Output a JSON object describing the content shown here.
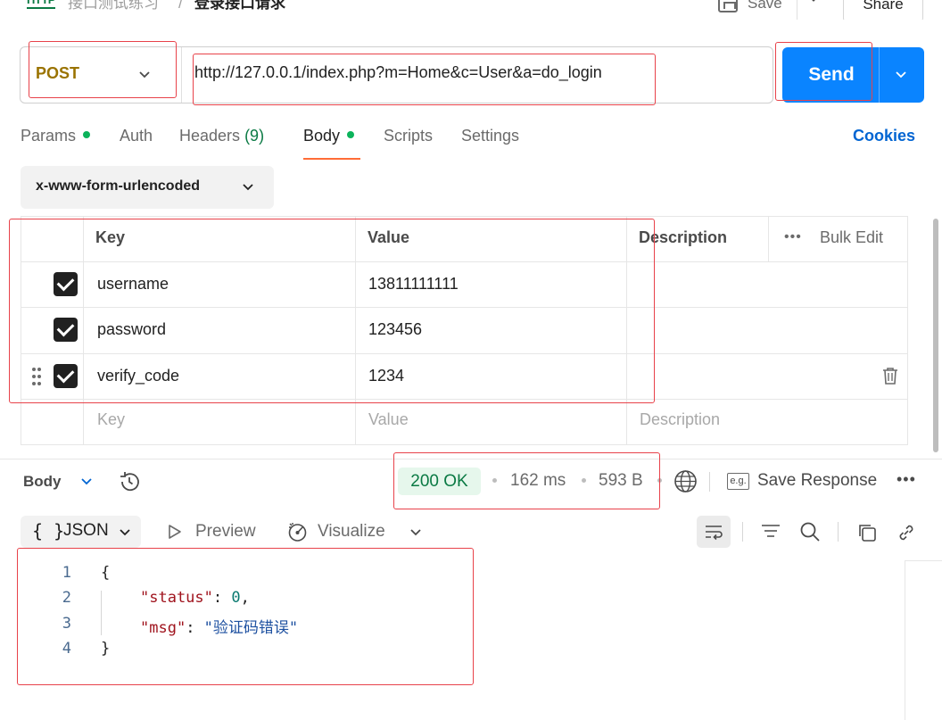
{
  "breadcrumb": {
    "badge": "HTTP",
    "parent": "接口测试练习",
    "separator": "/",
    "current": "登录接口请求"
  },
  "header_actions": {
    "save_label": "Save",
    "share_label": "Share"
  },
  "request": {
    "method": "POST",
    "url": "http://127.0.0.1/index.php?m=Home&c=User&a=do_login",
    "send_label": "Send"
  },
  "tabs": {
    "params": "Params",
    "auth": "Auth",
    "headers": "Headers",
    "headers_count": "(9)",
    "body": "Body",
    "scripts": "Scripts",
    "settings": "Settings",
    "cookies": "Cookies",
    "active": "Body"
  },
  "body_type": "x-www-form-urlencoded",
  "form_table": {
    "headers": {
      "key": "Key",
      "value": "Value",
      "description": "Description",
      "bulk_edit": "Bulk Edit"
    },
    "rows": [
      {
        "checked": true,
        "key": "username",
        "value": "13811111111",
        "description": ""
      },
      {
        "checked": true,
        "key": "password",
        "value": "123456",
        "description": ""
      },
      {
        "checked": true,
        "key": "verify_code",
        "value": "1234",
        "description": ""
      }
    ],
    "placeholder": {
      "key": "Key",
      "value": "Value",
      "description": "Description"
    }
  },
  "response": {
    "section_label": "Body",
    "status": "200 OK",
    "time": "162 ms",
    "size": "593 B",
    "save_response": "Save Response",
    "format": "JSON",
    "format_braces": "{ }",
    "preview": "Preview",
    "visualize": "Visualize",
    "code_lines": [
      {
        "num": "1",
        "text": "{"
      },
      {
        "num": "2",
        "key": "\"status\"",
        "sep": ": ",
        "value": "0",
        "tail": ","
      },
      {
        "num": "3",
        "key": "\"msg\"",
        "sep": ": ",
        "value": "\"验证码错误\"",
        "tail": ""
      },
      {
        "num": "4",
        "text": "}"
      }
    ]
  },
  "colors": {
    "accent": "#0a84ff",
    "method": "#9a7300",
    "status_ok": "#0b7a44",
    "annotation": "#e8424a",
    "active_tab": "#ff6c37"
  }
}
